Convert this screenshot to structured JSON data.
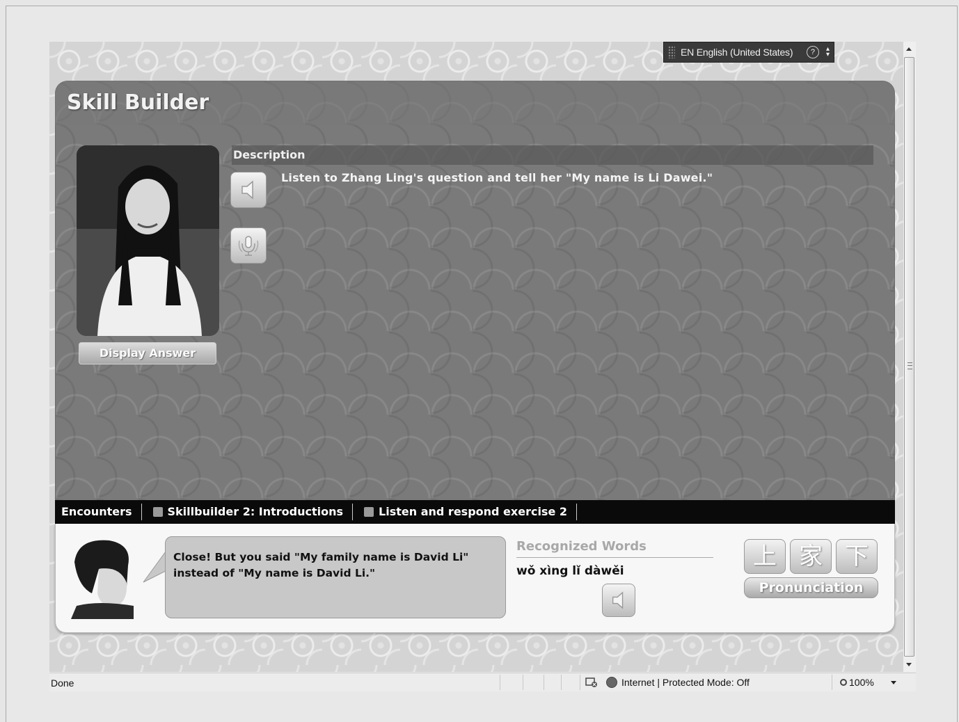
{
  "language_bar": {
    "language": "EN English (United States)",
    "help": "?"
  },
  "skill_builder": {
    "title": "Skill Builder",
    "display_answer_label": "Display Answer",
    "description_header": "Description",
    "description_text": "Listen to Zhang Ling's question and tell her \"My name is Li Dawei.\""
  },
  "breadcrumb": {
    "items": [
      "Encounters",
      "Skillbuilder 2: Introductions",
      "Listen and respond exercise 2"
    ]
  },
  "feedback": {
    "message": "Close! But you said \"My family name is David Li\" instead of \"My name is David Li.\"",
    "recognized_words_title": "Recognized Words",
    "recognized_words": "wǒ xìng lǐ dàwěi",
    "char_buttons": [
      "上",
      "家",
      "下"
    ],
    "pronunciation_label": "Pronunciation"
  },
  "status_bar": {
    "status": "Done",
    "zone": "Internet | Protected Mode: Off",
    "zoom": "100%"
  },
  "icons": [
    "speaker-icon",
    "microphone-icon",
    "help-icon",
    "globe-icon",
    "magnifier-icon"
  ]
}
